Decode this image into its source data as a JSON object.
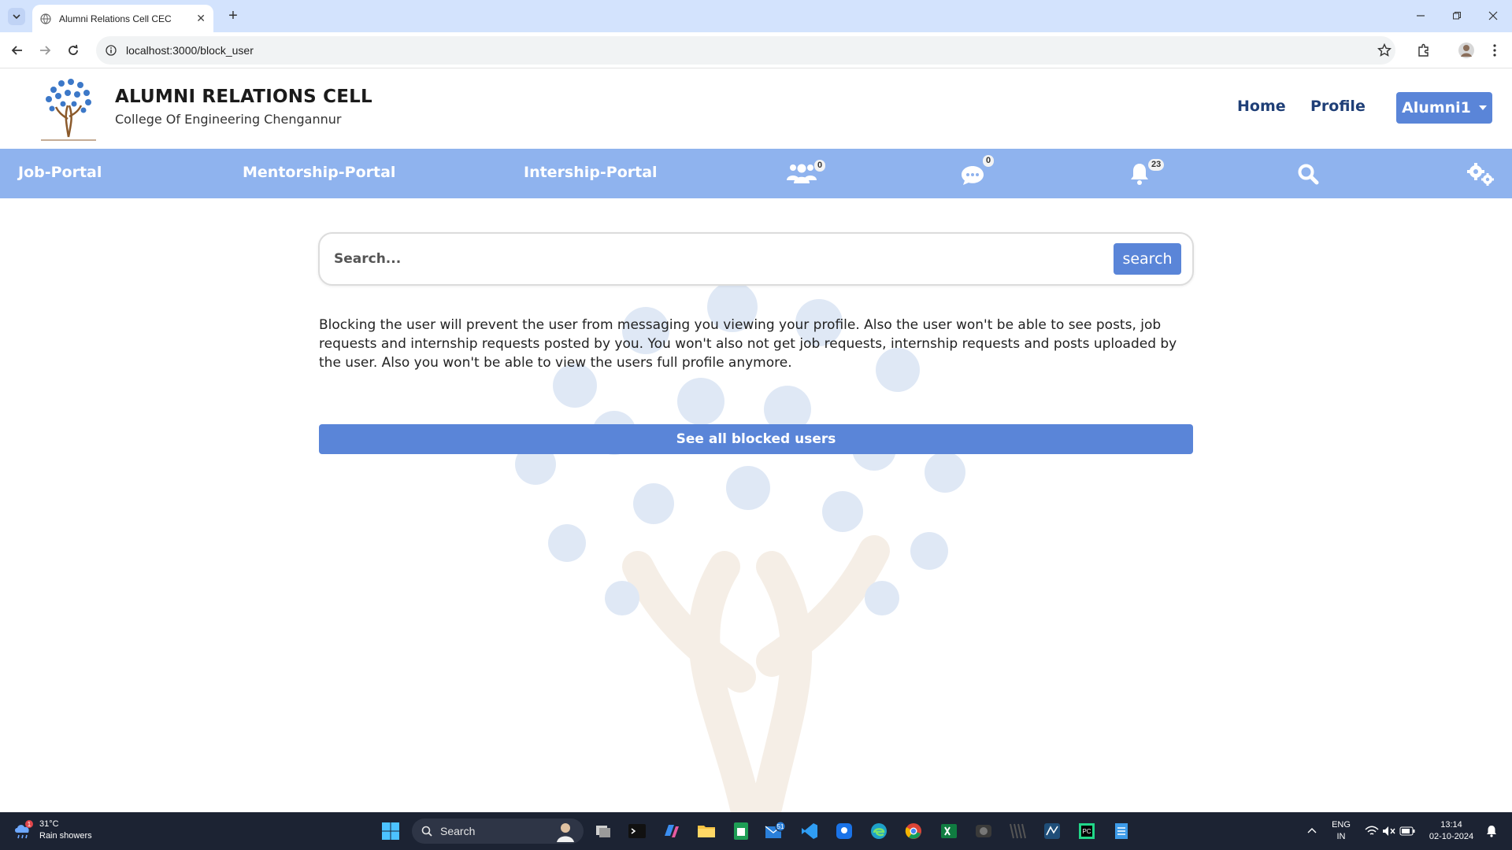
{
  "browser": {
    "tab_title": "Alumni Relations Cell CEC",
    "url": "localhost:3000/block_user"
  },
  "header": {
    "title": "ALUMNI RELATIONS CELL",
    "subtitle": "College Of Engineering Chengannur",
    "links": [
      "Home",
      "Profile"
    ],
    "user_menu": "Alumni1"
  },
  "navbar": {
    "items": [
      "Job-Portal",
      "Mentorship-Portal",
      "Intership-Portal"
    ],
    "connections_count": "0",
    "messages_count": "0",
    "notifications_count": "23"
  },
  "main": {
    "search_placeholder": "Search...",
    "search_button": "search",
    "info": "Blocking the user will prevent the user from messaging you viewing your profile. Also the user won't be able to see posts, job requests and internship requests posted by you. You won't also not get job requests, internship requests and posts uploaded by the user. Also you won't be able to view the users full profile anymore.",
    "blocked_button": "See all blocked users"
  },
  "taskbar": {
    "weather_temp": "31°C",
    "weather_desc": "Rain showers",
    "weather_badge": "1",
    "search_label": "Search",
    "mail_badge": "51",
    "lang_top": "ENG",
    "lang_bottom": "IN",
    "time": "13:14",
    "date": "02-10-2024"
  },
  "colors": {
    "accent": "#5a85d8",
    "navbar": "#8fb3ee",
    "header_link": "#1f3f77",
    "taskbar": "#1c2333"
  }
}
